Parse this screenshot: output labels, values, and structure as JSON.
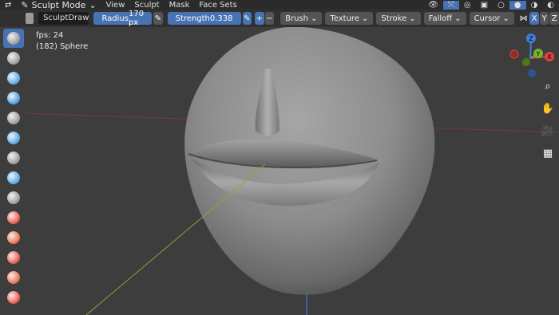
{
  "topbar": {
    "mode": "Sculpt Mode",
    "menus": [
      "View",
      "Sculpt",
      "Mask",
      "Face Sets"
    ]
  },
  "toolheader": {
    "brush_name": "SculptDraw",
    "radius_label": "Radius",
    "radius_value": "170 px",
    "strength_label": "Strength",
    "strength_value": "0.338",
    "plus_label": "+",
    "minus_label": "−",
    "dropdowns": [
      "Brush",
      "Texture",
      "Stroke",
      "Falloff",
      "Cursor"
    ]
  },
  "overlay": {
    "fps": "fps: 24",
    "object": "(182) Sphere"
  },
  "gizmo": {
    "axis_x": "X",
    "axis_y": "Y",
    "axis_z": "Z"
  },
  "axis_buttons": [
    "X",
    "Y",
    "Z"
  ],
  "colors": {
    "accent": "#4772b3",
    "x_axis": "#e0413b",
    "y_axis": "#77b52b",
    "z_axis": "#3f7fdc"
  },
  "icons": [
    "zoom-icon",
    "hand-icon",
    "camera-icon",
    "grid-icon"
  ]
}
